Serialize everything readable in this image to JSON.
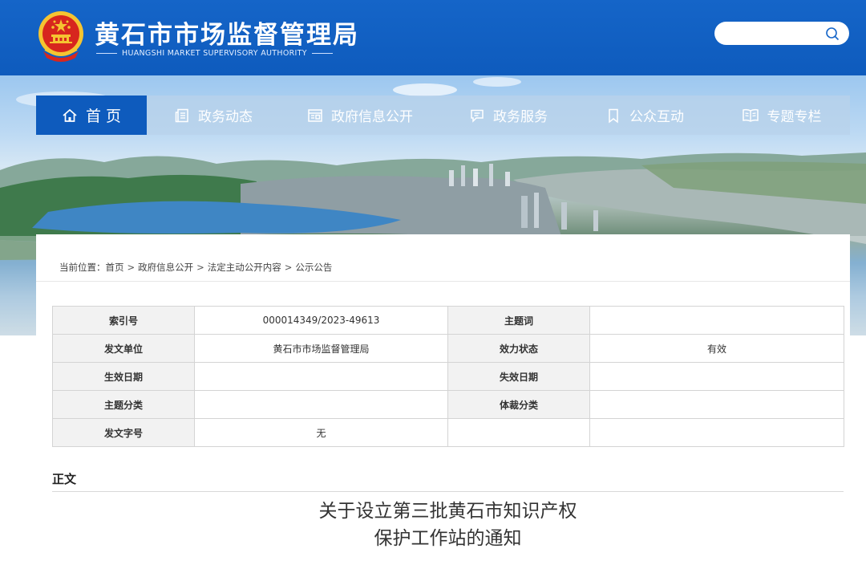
{
  "header": {
    "title": "黄石市市场监督管理局",
    "subtitle": "HUANGSHI MARKET SUPERVISORY AUTHORITY",
    "search_placeholder": ""
  },
  "nav": {
    "items": [
      {
        "label": "首 页",
        "icon": "home-icon",
        "active": true
      },
      {
        "label": "政务动态",
        "icon": "news-doc-icon",
        "active": false
      },
      {
        "label": "政府信息公开",
        "icon": "info-board-icon",
        "active": false
      },
      {
        "label": "政务服务",
        "icon": "service-chat-icon",
        "active": false
      },
      {
        "label": "公众互动",
        "icon": "bookmark-icon",
        "active": false
      },
      {
        "label": "专题专栏",
        "icon": "open-book-icon",
        "active": false
      }
    ]
  },
  "breadcrumb": {
    "prefix": "当前位置：",
    "items": [
      "首页",
      "政府信息公开",
      "法定主动公开内容",
      "公示公告"
    ],
    "sep": ">"
  },
  "meta_table": {
    "rows": [
      {
        "k1": "索引号",
        "v1": "000014349/2023-49613",
        "k2": "主题词",
        "v2": ""
      },
      {
        "k1": "发文单位",
        "v1": "黄石市市场监督管理局",
        "k2": "效力状态",
        "v2": "有效"
      },
      {
        "k1": "生效日期",
        "v1": "",
        "k2": "失效日期",
        "v2": ""
      },
      {
        "k1": "主题分类",
        "v1": "",
        "k2": "体裁分类",
        "v2": ""
      },
      {
        "k1": "发文字号",
        "v1": "无",
        "k2": "",
        "v2": ""
      }
    ]
  },
  "article": {
    "section_label": "正文",
    "title_line1": "关于设立第三批黄石市知识产权",
    "title_line2": "保护工作站的通知"
  },
  "colors": {
    "header_blue": "#1565c8",
    "nav_active": "#0e5bbd",
    "emblem_red": "#d7261e",
    "emblem_gold": "#f5c431"
  }
}
